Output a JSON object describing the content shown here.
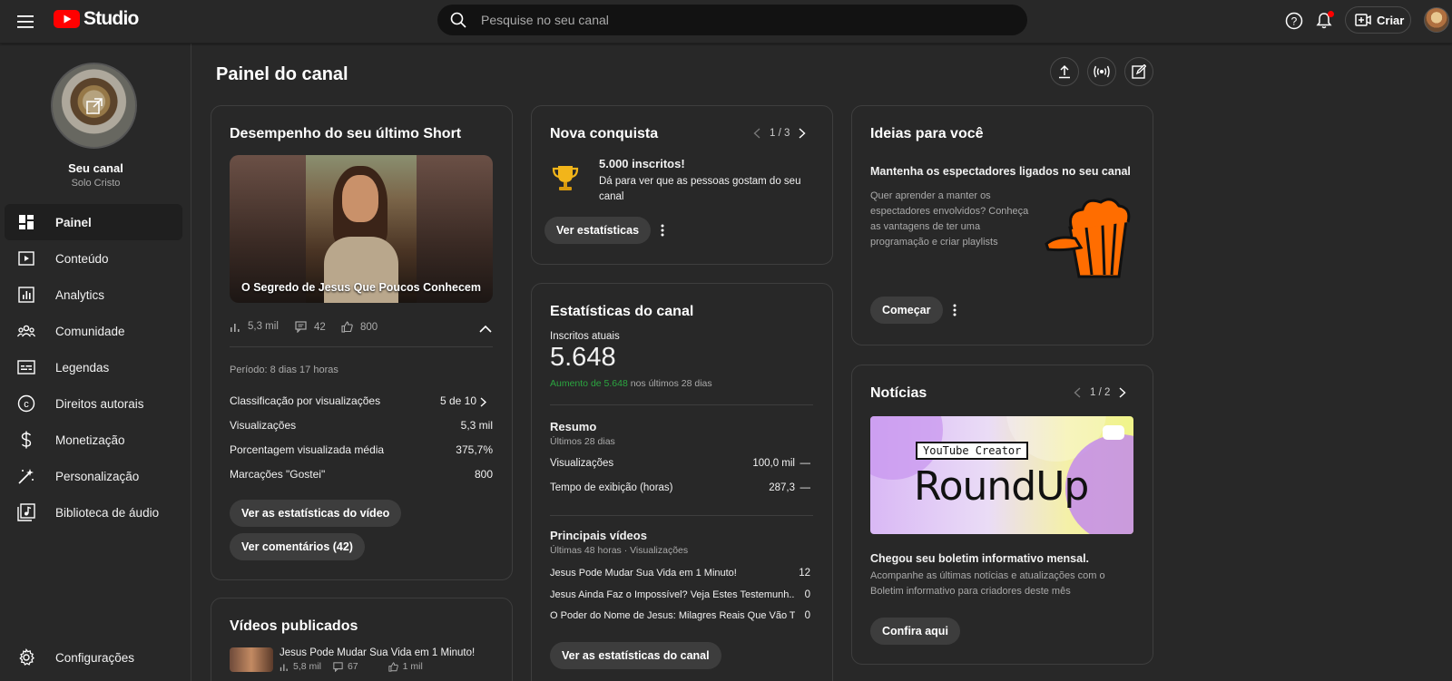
{
  "header": {
    "logo_text": "Studio",
    "search_placeholder": "Pesquise no seu canal",
    "create_label": "Criar"
  },
  "sidebar": {
    "channel_name": "Seu canal",
    "channel_handle": "Solo Cristo",
    "items": [
      {
        "label": "Painel",
        "icon": "dashboard-icon",
        "active": true
      },
      {
        "label": "Conteúdo",
        "icon": "content-icon"
      },
      {
        "label": "Analytics",
        "icon": "analytics-icon"
      },
      {
        "label": "Comunidade",
        "icon": "community-icon"
      },
      {
        "label": "Legendas",
        "icon": "subtitles-icon"
      },
      {
        "label": "Direitos autorais",
        "icon": "copyright-icon"
      },
      {
        "label": "Monetização",
        "icon": "monetization-icon"
      },
      {
        "label": "Personalização",
        "icon": "customization-icon"
      },
      {
        "label": "Biblioteca de áudio",
        "icon": "audio-library-icon"
      }
    ],
    "settings_label": "Configurações"
  },
  "page": {
    "title": "Painel do canal"
  },
  "short_card": {
    "title": "Desempenho do seu último Short",
    "thumbnail_caption": "O Segredo de Jesus Que Poucos Conhecem",
    "views": "5,3 mil",
    "comments": "42",
    "likes": "800",
    "period": "Período: 8 dias 17 horas",
    "rows": [
      {
        "label": "Classificação por visualizações",
        "value": "5 de 10"
      },
      {
        "label": "Visualizações",
        "value": "5,3 mil"
      },
      {
        "label": "Porcentagem visualizada média",
        "value": "375,7%"
      },
      {
        "label": "Marcações \"Gostei\"",
        "value": "800"
      }
    ],
    "btn_stats": "Ver as estatísticas do vídeo",
    "btn_comments": "Ver comentários (42)"
  },
  "videos_card": {
    "title": "Vídeos publicados",
    "video_title": "Jesus Pode Mudar Sua Vida em 1 Minuto!",
    "views": "5,8 mil",
    "comments": "67",
    "likes": "1 mil"
  },
  "achievement_card": {
    "title": "Nova conquista",
    "pager": "1 / 3",
    "headline": "5.000 inscritos!",
    "text": "Dá para ver que as pessoas gostam do seu canal",
    "button": "Ver estatísticas"
  },
  "stats_card": {
    "title": "Estatísticas do canal",
    "subs_label": "Inscritos atuais",
    "subs_value": "5.648",
    "growth_highlight": "Aumento de 5.648",
    "growth_rest": " nos últimos 28 dias",
    "summary_title": "Resumo",
    "summary_sub": "Últimos 28 dias",
    "summary_rows": [
      {
        "label": "Visualizações",
        "value": "100,0 mil",
        "trend": "—"
      },
      {
        "label": "Tempo de exibição (horas)",
        "value": "287,3",
        "trend": "—"
      }
    ],
    "top_title": "Principais vídeos",
    "top_sub": "Últimas 48 horas · Visualizações",
    "top_videos": [
      {
        "title": "Jesus Pode Mudar Sua Vida em 1 Minuto!",
        "value": "12"
      },
      {
        "title": "Jesus Ainda Faz o Impossível? Veja Estes Testemunh...",
        "value": "0"
      },
      {
        "title": "O Poder do Nome de Jesus: Milagres Reais Que Vão T...",
        "value": "0"
      }
    ],
    "button": "Ver as estatísticas do canal"
  },
  "ideas_card": {
    "title": "Ideias para você",
    "headline": "Mantenha os espectadores ligados no seu canal",
    "text": "Quer aprender a manter os espectadores envolvidos? Conheça as vantagens de ter uma programação e criar playlists",
    "button": "Começar"
  },
  "news_card": {
    "title": "Notícias",
    "pager": "1 / 2",
    "tag": "YouTube Creator",
    "banner": "RoundUp",
    "headline": "Chegou seu boletim informativo mensal.",
    "text": "Acompanhe as últimas notícias e atualizações com o Boletim informativo para criadores deste mês",
    "button": "Confira aqui"
  },
  "colors": {
    "background": "#282828",
    "brand_red": "#ff0000",
    "growth_green": "#2ba640",
    "popcorn_orange": "#ff6d00"
  }
}
